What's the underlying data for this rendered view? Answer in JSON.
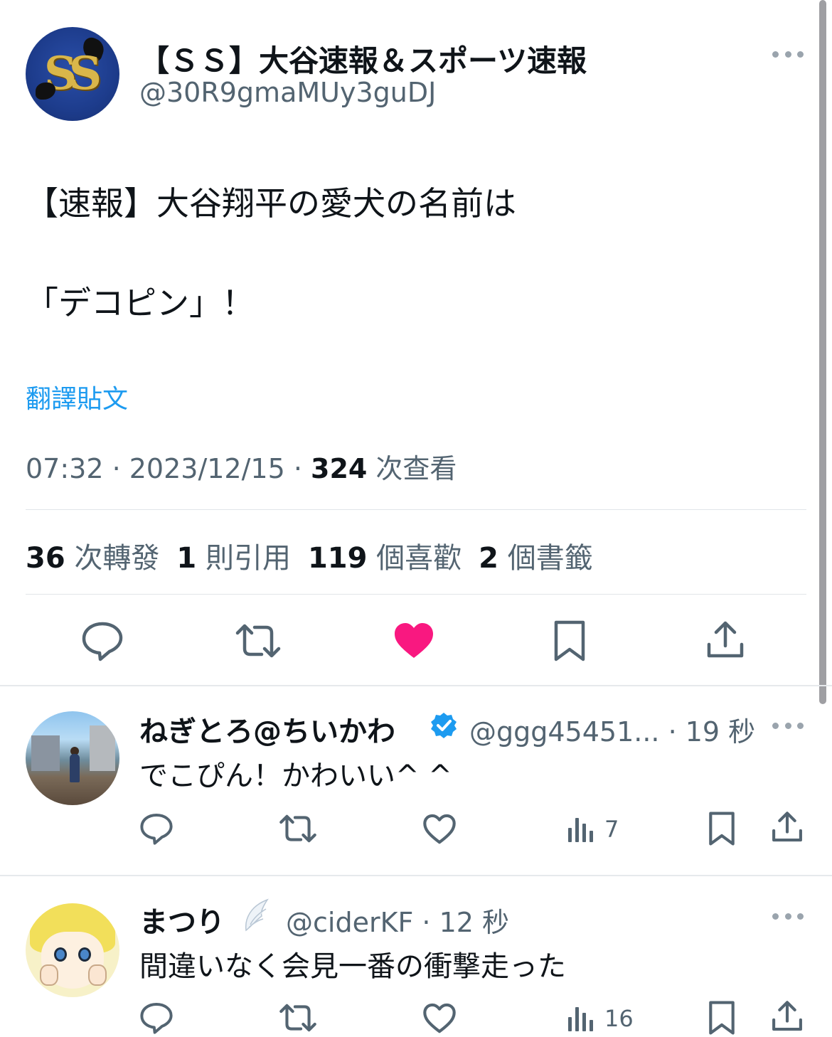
{
  "main_tweet": {
    "display_name": "【ＳＳ】大谷速報＆スポーツ速報",
    "handle": "@30R9gmaMUy3guDJ",
    "text_line1": "【速報】大谷翔平の愛犬の名前は",
    "text_line2": "「デコピン」！",
    "translate_link": "翻譯貼文",
    "time": "07:32 · 2023/12/15 · ",
    "views_count": "324",
    "views_label": " 次查看",
    "stats": {
      "retweets": "36",
      "retweets_label": " 次轉發",
      "quotes": "1",
      "quotes_label": " 則引用",
      "likes": "119",
      "likes_label": " 個喜歡",
      "bookmarks": "2",
      "bookmarks_label": " 個書籤"
    },
    "liked": true
  },
  "replies": [
    {
      "display_name": "ねぎとろ@ちいかわ",
      "verified": true,
      "handle_time": "@ggg45451... · 19 秒",
      "text": "でこぴん！かわいい^ ^",
      "views": "7"
    },
    {
      "display_name": "まつり",
      "badge": "angel-wing",
      "handle_time": "@ciderKF · 12 秒",
      "text": "間違いなく会見一番の衝撃走った",
      "views": "16"
    }
  ],
  "colors": {
    "text": "#0f1419",
    "secondary": "#536471",
    "link": "#1d9bf0",
    "like": "#f91880",
    "divider": "#e1e5e9"
  },
  "icons": [
    "reply-icon",
    "retweet-icon",
    "like-icon",
    "bookmark-icon",
    "share-icon",
    "views-icon",
    "more-icon",
    "verified-icon",
    "wing-icon"
  ]
}
